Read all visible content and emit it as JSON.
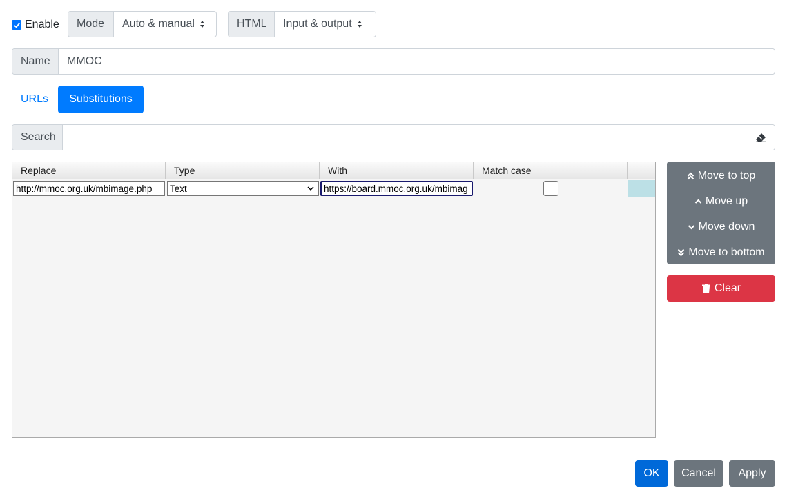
{
  "top": {
    "enable_label": "Enable",
    "enable_checked": true,
    "mode": {
      "label": "Mode",
      "selected": "Auto & manual"
    },
    "html": {
      "label": "HTML",
      "selected": "Input & output"
    }
  },
  "name": {
    "label": "Name",
    "value": "MMOC"
  },
  "tabs": [
    {
      "label": "URLs",
      "active": false
    },
    {
      "label": "Substitutions",
      "active": true
    }
  ],
  "search": {
    "label": "Search",
    "value": ""
  },
  "grid": {
    "columns": [
      "Replace",
      "Type",
      "With",
      "Match case"
    ],
    "rows": [
      {
        "replace": "http://mmoc.org.uk/mbimage.php",
        "type": "Text",
        "with": "https://board.mmoc.org.uk/mbimag",
        "match_case": false
      }
    ]
  },
  "side_buttons": {
    "move_top": "Move to top",
    "move_up": "Move up",
    "move_down": "Move down",
    "move_bottom": "Move to bottom",
    "clear": "Clear"
  },
  "footer": {
    "ok": "OK",
    "cancel": "Cancel",
    "apply": "Apply"
  },
  "colors": {
    "primary": "#007bff",
    "secondary": "#6c757d",
    "danger": "#dc3545"
  }
}
